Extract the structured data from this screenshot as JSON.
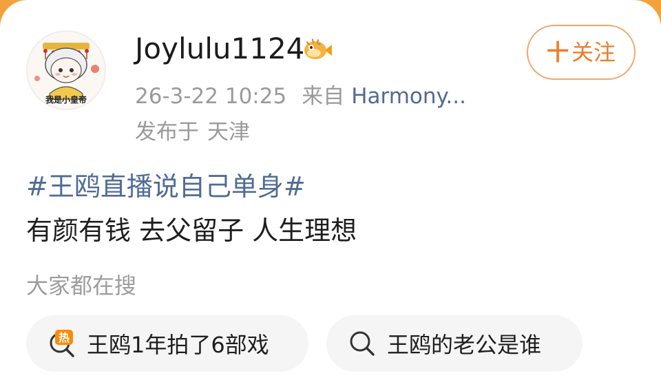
{
  "post": {
    "author": {
      "name": "Joylulu1124",
      "avatar_caption": "我是小皇帝",
      "badge_icon": "pufferfish-badge-icon"
    },
    "time": "26-3-22 10:25",
    "source_label": "来自",
    "source_device": "Harmony...",
    "location_prefix": "发布于",
    "location": "天津",
    "follow": {
      "plus": "十",
      "label": "关注"
    },
    "hashtag": "#王鸥直播说自己单身#",
    "text": "有颜有钱 去父留子 人生理想"
  },
  "search": {
    "title": "大家都在搜",
    "items": [
      {
        "icon": "hot-search-icon",
        "hot_badge": "热",
        "label": "王鸥1年拍了6部戏"
      },
      {
        "icon": "search-icon",
        "label": "王鸥的老公是谁"
      }
    ]
  },
  "colors": {
    "accent": "#ee7c2b",
    "link": "#506c94",
    "muted": "#9a9a9a",
    "chip_bg": "#f5f5f5",
    "top_frame": "#f3a23b"
  }
}
